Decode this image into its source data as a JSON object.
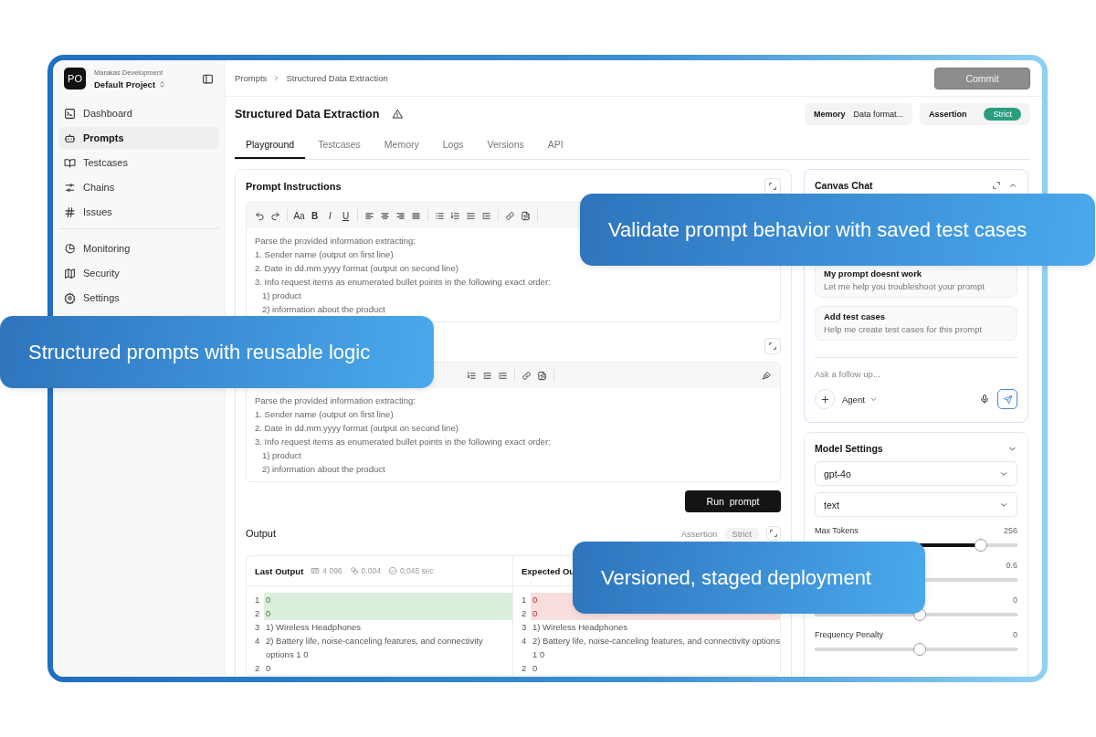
{
  "sidebar": {
    "avatar": "PO",
    "org": "Marakas Development",
    "project": "Default Project",
    "items": [
      {
        "label": "Dashboard",
        "selected": false
      },
      {
        "label": "Prompts",
        "selected": true
      },
      {
        "label": "Testcases",
        "selected": false
      },
      {
        "label": "Chains",
        "selected": false
      },
      {
        "label": "Issues",
        "selected": false
      }
    ],
    "bottom_items": [
      {
        "label": "Monitoring",
        "selected": false
      },
      {
        "label": "Security",
        "selected": false
      },
      {
        "label": "Settings",
        "selected": false
      }
    ]
  },
  "header": {
    "breadcrumb": [
      "Prompts",
      "Structured Data Extraction"
    ],
    "commit": "Commit",
    "title": "Structured Data Extraction",
    "memory": {
      "label": "Memory",
      "value": "Data format..."
    },
    "assertion": {
      "label": "Assertion",
      "value": "Strict"
    }
  },
  "tabs": [
    {
      "label": "Playground",
      "selected": true
    },
    {
      "label": "Testcases",
      "selected": false
    },
    {
      "label": "Memory",
      "selected": false
    },
    {
      "label": "Logs",
      "selected": false
    },
    {
      "label": "Versions",
      "selected": false
    },
    {
      "label": "API",
      "selected": false
    }
  ],
  "prompt_instructions": {
    "title": "Prompt Instructions",
    "text_buttons": [
      "Aa",
      "B",
      "I",
      "U"
    ],
    "lines": [
      "Parse the provided information extracting:",
      "1. Sender name (output on first line)",
      "2. Date in dd.mm.yyyy format (output on second line)",
      "3. Info request items as enumerated bullet points in the following exact order:",
      "   1) product",
      "   2) information about the product"
    ]
  },
  "second_editor": {
    "lines": [
      "Parse the provided information extracting:",
      "1. Sender name (output on first line)",
      "2. Date in dd.mm.yyyy format (output on second line)",
      "3. Info request items as enumerated bullet points in the following exact order:",
      "   1) product",
      "   2) information about the product"
    ]
  },
  "run_button": "Run  prompt",
  "output": {
    "title": "Output",
    "assertion_label": "Assertion",
    "assertion_value": "Strict",
    "columns": [
      {
        "title": "Last Output",
        "stats": [
          "4 096",
          "0.004",
          "0,045 sec"
        ],
        "lines": [
          {
            "number": "1",
            "text": "0",
            "added": true,
            "removed": false
          },
          {
            "number": "2",
            "text": "0",
            "added": true,
            "removed": false
          },
          {
            "number": "3",
            "text": "1) Wireless Headphones",
            "added": false,
            "removed": false
          },
          {
            "number": "4",
            "text": "2) Battery life, noise-canceling features, and connectivity options 1  0",
            "added": false,
            "removed": false
          },
          {
            "number": "2",
            "text": "0",
            "added": false,
            "removed": false
          }
        ]
      },
      {
        "title": "Expected Ou",
        "lines": [
          {
            "number": "1",
            "text": "0",
            "added": false,
            "removed": true
          },
          {
            "number": "2",
            "text": "0",
            "added": false,
            "removed": true
          },
          {
            "number": "3",
            "text": "1) Wireless Headphones",
            "added": false,
            "removed": false
          },
          {
            "number": "4",
            "text": "2) Battery life, noise-canceling features, and connectivity options 1  0",
            "added": false,
            "removed": false
          },
          {
            "number": "2",
            "text": "0",
            "added": false,
            "removed": false
          }
        ]
      }
    ]
  },
  "canvas_chat": {
    "title": "Canvas Chat",
    "suggestions": [
      {
        "title": "My prompt doesnt work",
        "subtitle": "Let me help you troubleshoot your prompt"
      },
      {
        "title": "Add test cases",
        "subtitle": "Help me create test cases for this prompt"
      }
    ],
    "placeholder": "Ask a follow up...",
    "agent": "Agent"
  },
  "model_settings": {
    "title": "Model Settings",
    "selects": [
      "gpt-4o",
      "text"
    ],
    "sliders": [
      {
        "label": "Max Tokens",
        "reading": "256",
        "level": 0.82
      },
      {
        "reading": "0.6"
      },
      {
        "reading": "0",
        "level": 0.52
      },
      {
        "label": "Frequency Penalty",
        "reading": "0",
        "level": 0.52
      }
    ]
  },
  "callouts": [
    {
      "text": "Validate prompt behavior with saved test cases"
    },
    {
      "text": "Structured prompts with reusable logic"
    },
    {
      "text": "Versioned, staged deployment"
    }
  ]
}
